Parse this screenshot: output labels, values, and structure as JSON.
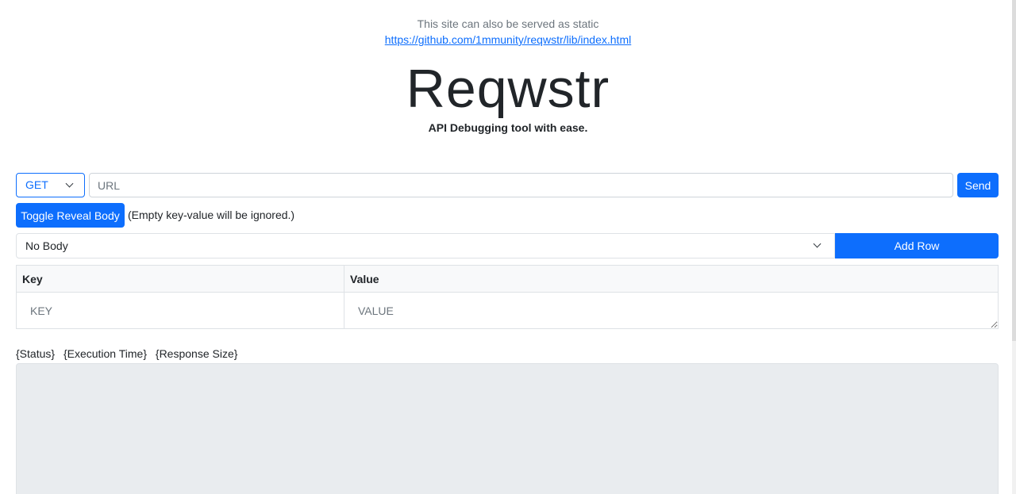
{
  "notice": {
    "text": "This site can also be served as static",
    "link": "https://github.com/1mmunity/reqwstr/lib/index.html"
  },
  "header": {
    "title": "Reqwstr",
    "subtitle": "API Debugging tool with ease."
  },
  "request": {
    "method": "GET",
    "url_placeholder": "URL",
    "url_value": "",
    "send_label": "Send"
  },
  "body": {
    "toggle_label": "Toggle Reveal Body",
    "hint": "(Empty key-value will be ignored.)",
    "type": "No Body",
    "add_row_label": "Add Row"
  },
  "table": {
    "headers": [
      "Key",
      "Value"
    ],
    "key_placeholder": "KEY",
    "value_placeholder": "VALUE"
  },
  "response": {
    "status": "{Status}",
    "execution_time": "{Execution Time}",
    "response_size": "{Response Size}"
  }
}
